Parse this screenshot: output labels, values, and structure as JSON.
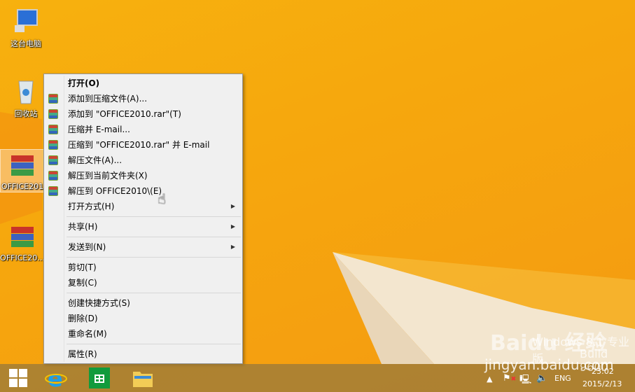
{
  "desktop": {
    "icons": [
      {
        "label": "这台电脑",
        "icon": "computer-icon"
      },
      {
        "label": "回收站",
        "icon": "recycle-bin-icon"
      },
      {
        "label": "OFFICE201",
        "icon": "winrar-archive-icon",
        "selected": true
      },
      {
        "label": "OFFICE20...",
        "icon": "winrar-archive-icon"
      }
    ]
  },
  "menu": {
    "groups": [
      [
        {
          "label": "打开(O)",
          "bold": true
        },
        {
          "label": "添加到压缩文件(A)...",
          "icon": "winrar-icon"
        },
        {
          "label": "添加到 \"OFFICE2010.rar\"(T)",
          "icon": "winrar-icon"
        },
        {
          "label": "压缩并 E-mail...",
          "icon": "winrar-icon"
        },
        {
          "label": "压缩到 \"OFFICE2010.rar\" 并 E-mail",
          "icon": "winrar-icon"
        },
        {
          "label": "解压文件(A)...",
          "icon": "winrar-icon"
        },
        {
          "label": "解压到当前文件夹(X)",
          "icon": "winrar-icon"
        },
        {
          "label": "解压到 OFFICE2010\\(E)",
          "icon": "winrar-icon",
          "hovered": true
        },
        {
          "label": "打开方式(H)",
          "submenu": true
        }
      ],
      [
        {
          "label": "共享(H)",
          "submenu": true
        }
      ],
      [
        {
          "label": "发送到(N)",
          "submenu": true
        }
      ],
      [
        {
          "label": "剪切(T)"
        },
        {
          "label": "复制(C)"
        }
      ],
      [
        {
          "label": "创建快捷方式(S)"
        },
        {
          "label": "删除(D)"
        },
        {
          "label": "重命名(M)"
        }
      ],
      [
        {
          "label": "属性(R)"
        }
      ]
    ]
  },
  "watermark": {
    "os": "Windows 8.1 专业版",
    "build": "Build 9600",
    "baidu": "Baidu 经验",
    "url": "jingyan.baidu.com"
  },
  "taskbar": {
    "apps": [
      "start-icon",
      "internet-explorer-icon",
      "store-icon",
      "file-explorer-icon"
    ],
    "lang": "ENG",
    "time": "23:02",
    "date": "2015/2/13"
  },
  "colors": {
    "desktop": "#f7b10e",
    "menu": "#f0f0f0"
  }
}
